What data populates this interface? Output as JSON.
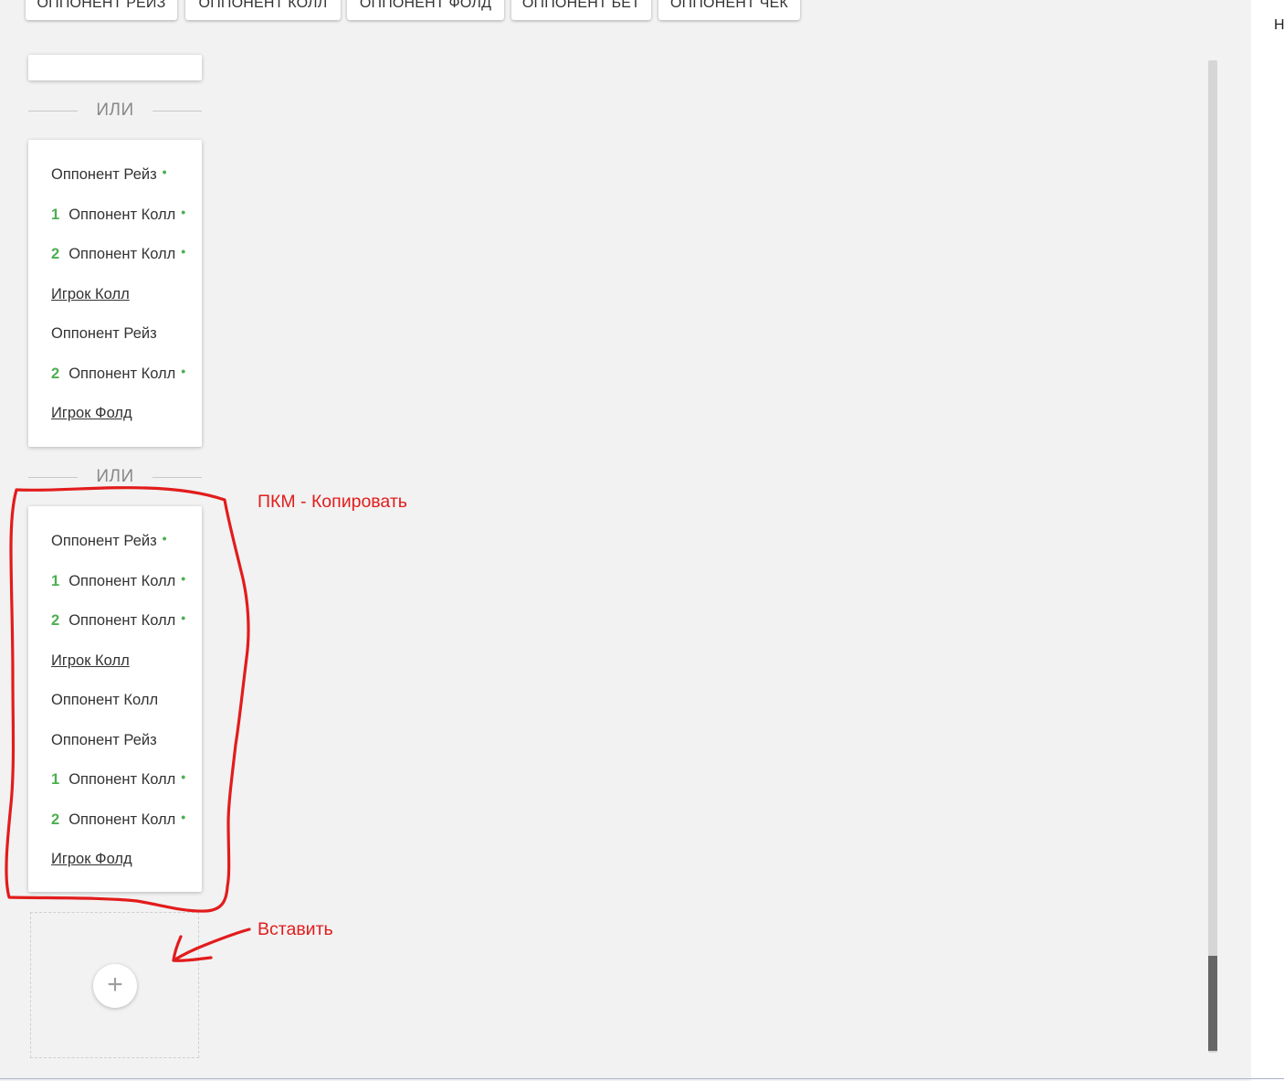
{
  "toolbar": {
    "buttons": [
      {
        "label": "ОППОНЕНТ РЕЙЗ"
      },
      {
        "label": "ОППОНЕНТ КОЛЛ"
      },
      {
        "label": "ОППОНЕНТ ФОЛД"
      },
      {
        "label": "ОППОНЕНТ БЕТ"
      },
      {
        "label": "ОППОНЕНТ ЧЕК"
      }
    ]
  },
  "divider_label": "ИЛИ",
  "cards": [
    {
      "rows": [
        {
          "num": "",
          "text": "Оппонент Рейз",
          "dot": "•"
        },
        {
          "num": "1",
          "text": "Оппонент Колл",
          "dot": "•"
        },
        {
          "num": "2",
          "text": "Оппонент Колл",
          "dot": "•"
        },
        {
          "num": "",
          "text": "Игрок Колл",
          "dot": ""
        },
        {
          "num": "",
          "text": "Оппонент Рейз",
          "dot": ""
        },
        {
          "num": "2",
          "text": "Оппонент Колл",
          "dot": "•"
        },
        {
          "num": "",
          "text": "Игрок Фолд",
          "dot": ""
        }
      ]
    },
    {
      "rows": [
        {
          "num": "",
          "text": "Оппонент Рейз",
          "dot": "•"
        },
        {
          "num": "1",
          "text": "Оппонент Колл",
          "dot": "•"
        },
        {
          "num": "2",
          "text": "Оппонент Колл",
          "dot": "•"
        },
        {
          "num": "",
          "text": "Игрок Колл",
          "dot": ""
        },
        {
          "num": "",
          "text": "Оппонент Колл",
          "dot": ""
        },
        {
          "num": "",
          "text": "Оппонент Рейз",
          "dot": ""
        },
        {
          "num": "1",
          "text": "Оппонент Колл",
          "dot": "•"
        },
        {
          "num": "2",
          "text": "Оппонент Колл",
          "dot": "•"
        },
        {
          "num": "",
          "text": "Игрок Фолд",
          "dot": ""
        }
      ]
    }
  ],
  "add_button": {
    "symbol": "+",
    "icon": "plus-icon"
  },
  "annotations": {
    "copy": "ПКМ - Копировать",
    "paste": "Вставить"
  },
  "right_panel": {
    "letter": "Н"
  },
  "colors": {
    "accent_green": "#4caf50",
    "annotation_red": "#e21c1c"
  }
}
